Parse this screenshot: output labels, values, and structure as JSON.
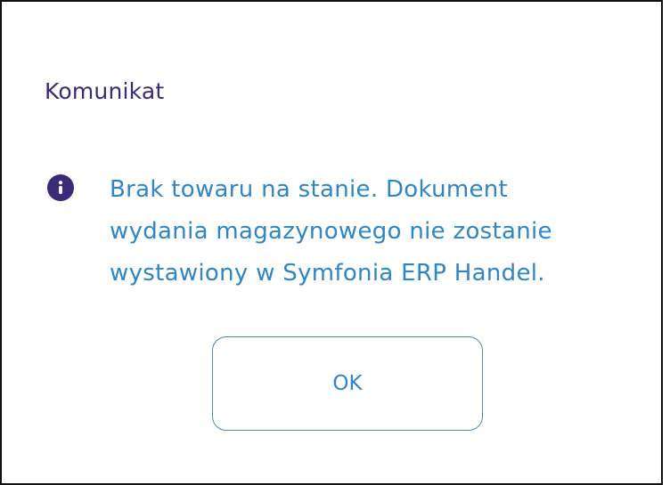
{
  "dialog": {
    "title": "Komunikat",
    "icon": "info-icon",
    "message_lines": [
      "Brak towaru na stanie. Dokument",
      "wydania magazynowego nie zostanie",
      "wystawiony w Symfonia ERP Handel."
    ],
    "ok_label": "OK"
  },
  "colors": {
    "title": "#3b2a78",
    "icon_bg": "#3b2a78",
    "message": "#2f86c7",
    "button_border": "#4b88b8",
    "border": "#111111"
  }
}
